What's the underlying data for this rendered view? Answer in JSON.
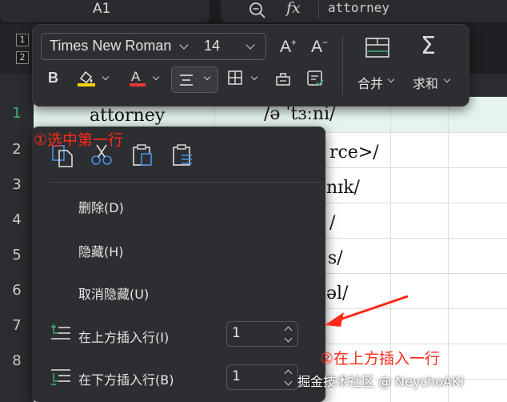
{
  "formula_bar": {
    "cell_ref": "A1",
    "zoom_icon": "zoom-icon",
    "fx_label": "fx",
    "formula_value": "attorney"
  },
  "outline_levels": [
    "1",
    "2"
  ],
  "rows": [
    "1",
    "2",
    "3",
    "4",
    "5",
    "6",
    "7",
    "8"
  ],
  "cells": {
    "a1": "attorney",
    "b1": "/ə ˈtɜːni/",
    "b2": "rce>/",
    "b3": "nɪk/",
    "b4": "/",
    "b5": "s/",
    "b6": "əl/"
  },
  "toolbar": {
    "font_name": "Times New Roman",
    "font_size": "14",
    "merge_label": "合并",
    "sum_label": "求和",
    "font_color": "#e53935",
    "highlight_color": "#f5d300"
  },
  "context_menu": {
    "items": {
      "delete": "删除(D)",
      "hide": "隐藏(H)",
      "unhide": "取消隐藏(U)",
      "insert_above": "在上方插入行(I)",
      "insert_below": "在下方插入行(B)"
    },
    "insert_above_count": "1",
    "insert_below_count": "1"
  },
  "annotations": {
    "step1": "①选中第一行",
    "step2": "②在上方插入一行",
    "color": "#ff2a1a"
  },
  "watermark": "掘金技术社区 @ NeychoAKi"
}
